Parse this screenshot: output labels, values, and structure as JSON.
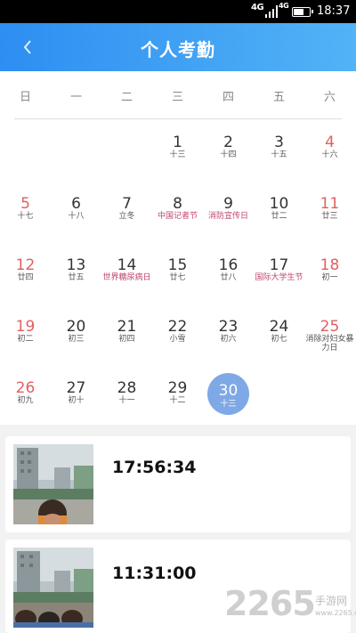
{
  "status_bar": {
    "network1": "4G",
    "network2": "4G",
    "time": "18:37"
  },
  "header": {
    "back_icon": "chevron-left-icon",
    "title": "个人考勤"
  },
  "calendar": {
    "weekdays": [
      "日",
      "一",
      "二",
      "三",
      "四",
      "五",
      "六"
    ],
    "days": [
      {
        "day": "1",
        "sub": "十三"
      },
      {
        "day": "2",
        "sub": "十四"
      },
      {
        "day": "3",
        "sub": "十五"
      },
      {
        "day": "4",
        "sub": "十六"
      },
      {
        "day": "5",
        "sub": "十七"
      },
      {
        "day": "6",
        "sub": "十八"
      },
      {
        "day": "7",
        "sub": "立冬"
      },
      {
        "day": "8",
        "sub": "中国记者节",
        "festival": true
      },
      {
        "day": "9",
        "sub": "消防宣传日",
        "festival": true
      },
      {
        "day": "10",
        "sub": "廿二"
      },
      {
        "day": "11",
        "sub": "廿三"
      },
      {
        "day": "12",
        "sub": "廿四"
      },
      {
        "day": "13",
        "sub": "廿五"
      },
      {
        "day": "14",
        "sub": "世界糖尿病日",
        "festival": true
      },
      {
        "day": "15",
        "sub": "廿七"
      },
      {
        "day": "16",
        "sub": "廿八"
      },
      {
        "day": "17",
        "sub": "国际大学生节",
        "festival": true
      },
      {
        "day": "18",
        "sub": "初一"
      },
      {
        "day": "19",
        "sub": "初二"
      },
      {
        "day": "20",
        "sub": "初三"
      },
      {
        "day": "21",
        "sub": "初四"
      },
      {
        "day": "22",
        "sub": "小雪"
      },
      {
        "day": "23",
        "sub": "初六"
      },
      {
        "day": "24",
        "sub": "初七"
      },
      {
        "day": "25",
        "sub": "消除对妇女暴力日",
        "festival": true
      },
      {
        "day": "26",
        "sub": "初九"
      },
      {
        "day": "27",
        "sub": "初十"
      },
      {
        "day": "28",
        "sub": "十一"
      },
      {
        "day": "29",
        "sub": "十二"
      },
      {
        "day": "30",
        "sub": "十三",
        "selected": true
      }
    ],
    "colors": {
      "weekend": "#e06060",
      "festival": "#c0466a",
      "selected": "#7fa8e6"
    }
  },
  "records": [
    {
      "time": "17:56:34",
      "photo": "attendance-photo"
    },
    {
      "time": "11:31:00",
      "photo": "attendance-photo"
    }
  ],
  "watermark": {
    "number": "2265",
    "text": "手游网",
    "url": "www.2265.com"
  },
  "colors": {
    "header_start": "#2e8ef2",
    "header_end": "#52b3f6"
  }
}
